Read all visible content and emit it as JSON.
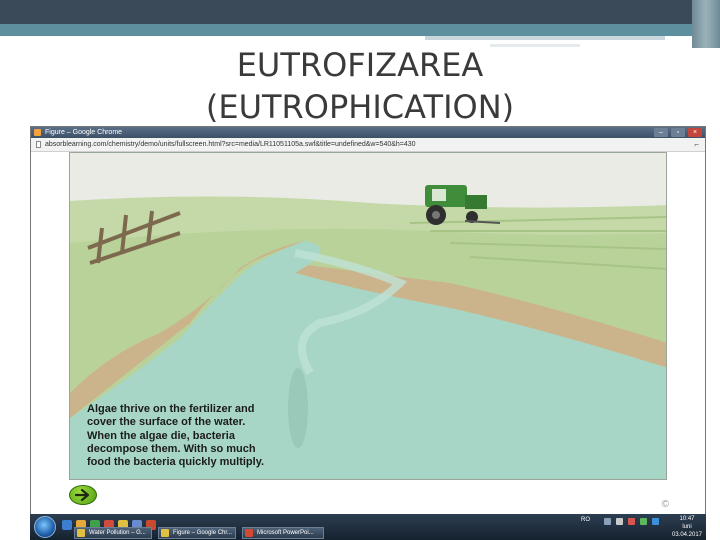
{
  "slide": {
    "title_line1": "EUTROFIZAREA",
    "title_line2": "(EUTROPHICATION)"
  },
  "browser": {
    "window_title": "Figure – Google Chrome",
    "url": "absorblearning.com/chemistry/demo/units/fullscreen.html?src=media/LR11051105a.swf&title=undefined&w=540&h=430",
    "controls": {
      "minimize": "–",
      "maximize": "▫",
      "close": "×"
    }
  },
  "scene": {
    "caption_lines": [
      "Algae thrive on the fertilizer and",
      "cover the surface of the water.",
      "When the algae die, bacteria",
      "decompose them. With so much",
      "food the bacteria quickly multiply."
    ],
    "next_button_icon": "arrow-right-icon",
    "copyright": "©",
    "colors": {
      "sky": "#e9ebe4",
      "field": "#b9d29a",
      "bank": "#cbb48c",
      "water": "#a7d6c6",
      "tractor": "#3f8c3a"
    }
  },
  "taskbar": {
    "items": [
      {
        "label": "Water Pollution – G...",
        "icon": "chrome-icon"
      },
      {
        "label": "Figure – Google Chr...",
        "icon": "chrome-icon"
      },
      {
        "label": "Microsoft PowerPoi...",
        "icon": "powerpoint-icon"
      }
    ],
    "language": "RO",
    "time": "10:47",
    "day": "luni",
    "date": "03.04.2017"
  }
}
